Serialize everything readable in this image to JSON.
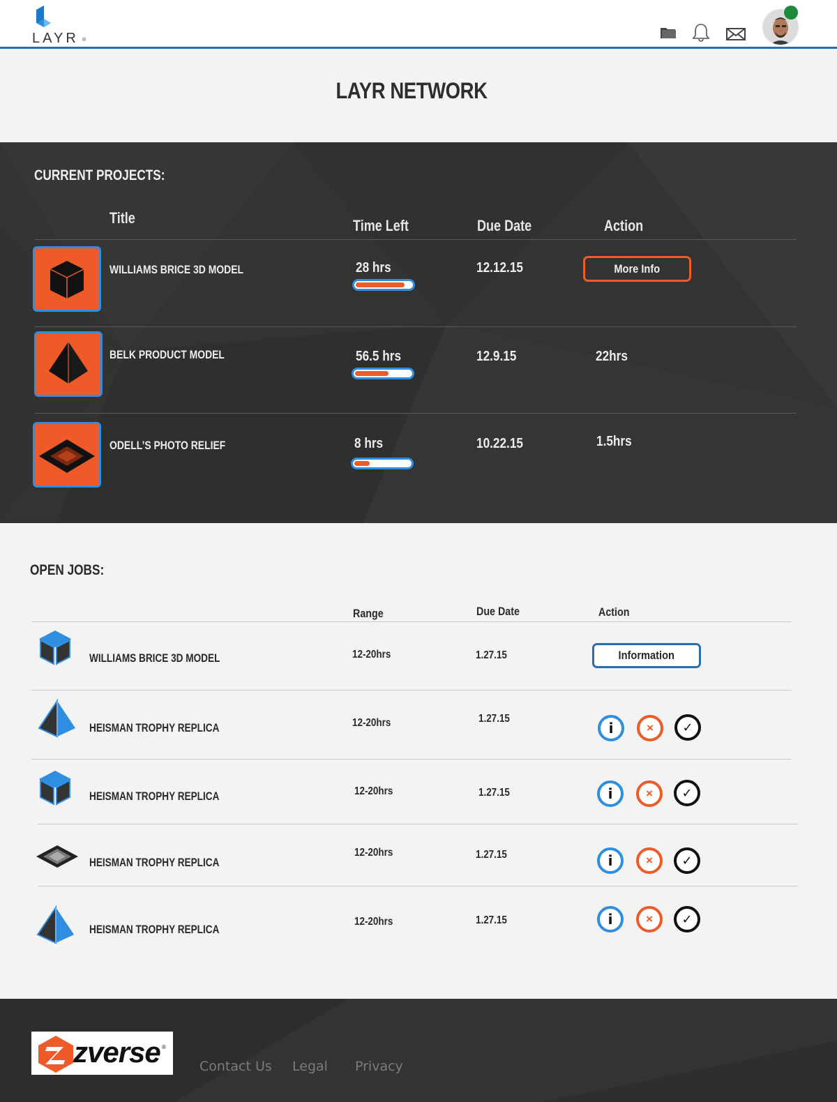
{
  "header": {
    "logo_text": "LAYR",
    "icons": [
      "folder-icon",
      "bell-icon",
      "envelope-icon"
    ],
    "user_online": true
  },
  "page_title": "LAYR NETWORK",
  "current_projects": {
    "title": "CURRENT PROJECTS:",
    "columns": {
      "title": "Title",
      "time_left": "Time Left",
      "due_date": "Due Date",
      "action": "Action"
    },
    "rows": [
      {
        "name": "WILLIAMS BRICE 3D MODEL",
        "time_left": "28 hrs",
        "progress": 0.88,
        "due_date": "12.12.15",
        "action": "More Info",
        "icon": "cube-icon"
      },
      {
        "name": "BELK PRODUCT MODEL",
        "time_left": "56.5 hrs",
        "progress": 0.6,
        "due_date": "12.9.15",
        "action": "22hrs",
        "icon": "pyramid-icon"
      },
      {
        "name": "ODELL’S PHOTO RELIEF",
        "time_left": "8 hrs",
        "progress": 0.28,
        "due_date": "10.22.15",
        "action": "1.5hrs",
        "icon": "relief-icon"
      }
    ]
  },
  "open_jobs": {
    "title": "OPEN JOBS:",
    "columns": {
      "range": "Range",
      "due_date": "Due Date",
      "action": "Action"
    },
    "rows": [
      {
        "name": "WILLIAMS BRICE 3D MODEL",
        "range": "12-20hrs",
        "due_date": "1.27.15",
        "action": "Information",
        "icon": "cube-icon"
      },
      {
        "name": "HEISMAN TROPHY REPLICA",
        "range": "12-20hrs",
        "due_date": "1.27.15",
        "icon": "pyramid-icon"
      },
      {
        "name": "HEISMAN TROPHY REPLICA",
        "range": "12-20hrs",
        "due_date": "1.27.15",
        "icon": "cube-icon"
      },
      {
        "name": "HEISMAN TROPHY REPLICA",
        "range": "12-20hrs",
        "due_date": "1.27.15",
        "icon": "relief-icon"
      },
      {
        "name": "HEISMAN TROPHY REPLICA",
        "range": "12-20hrs",
        "due_date": "1.27.15",
        "icon": "pyramid-icon"
      }
    ],
    "row_actions": {
      "info": "i",
      "decline": "×",
      "accept": "✓"
    }
  },
  "footer": {
    "brand": "zverse",
    "links": [
      "Contact Us",
      "Legal",
      "Privacy"
    ]
  },
  "colors": {
    "accent_orange": "#ee5a28",
    "accent_blue": "#2f8ee0",
    "header_rule": "#2a6db3",
    "dark_panel": "#333334",
    "status_online": "#1f8a3b"
  }
}
